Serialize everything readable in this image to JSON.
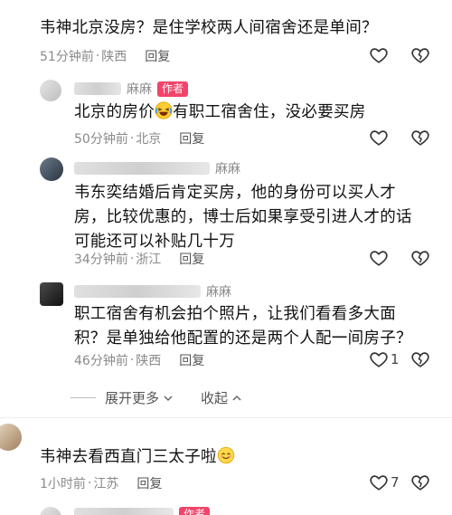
{
  "comments": [
    {
      "text": "韦神北京没房？是住学校两人间宿舍还是单间？",
      "time": "51分钟前",
      "location": "陕西",
      "reply_label": "回复",
      "likes": ""
    },
    {
      "name": "麻麻",
      "badge": "作者",
      "text_before": "北京的房价",
      "text_after": "有职工宿舍住，没必要买房",
      "time": "50分钟前",
      "location": "北京",
      "reply_label": "回复",
      "likes": ""
    },
    {
      "name": "麻麻",
      "text_lines": [
        "韦东奕结婚后肯定买房，他的身份可以买人才",
        "房，比较优惠的，博士后如果享受引进人才的话",
        "可能还可以补贴几十万"
      ],
      "time": "34分钟前",
      "location": "浙江",
      "reply_label": "回复",
      "likes": ""
    },
    {
      "name": "麻麻",
      "text_lines": [
        "职工宿舍有机会拍个照片，让我们看看多大面",
        "积？是单独给他配置的还是两个人配一间房子？"
      ],
      "time": "46分钟前",
      "location": "陕西",
      "reply_label": "回复",
      "likes": "1"
    },
    {
      "text_before": "韦神去看西直门三太子啦",
      "time": "1小时前",
      "location": "江苏",
      "reply_label": "回复",
      "likes": "7"
    }
  ],
  "thread": {
    "expand_label": "展开更多",
    "collapse_label": "收起"
  },
  "next": {
    "badge": "作者"
  },
  "colors": {
    "badge_bg": "#f2446a",
    "meta": "#8a8a8a"
  },
  "icons": [
    "heart-icon",
    "broken-heart-icon",
    "chevron-down-icon",
    "chevron-up-icon",
    "laughing-emoji-icon",
    "smile-emoji-icon"
  ]
}
